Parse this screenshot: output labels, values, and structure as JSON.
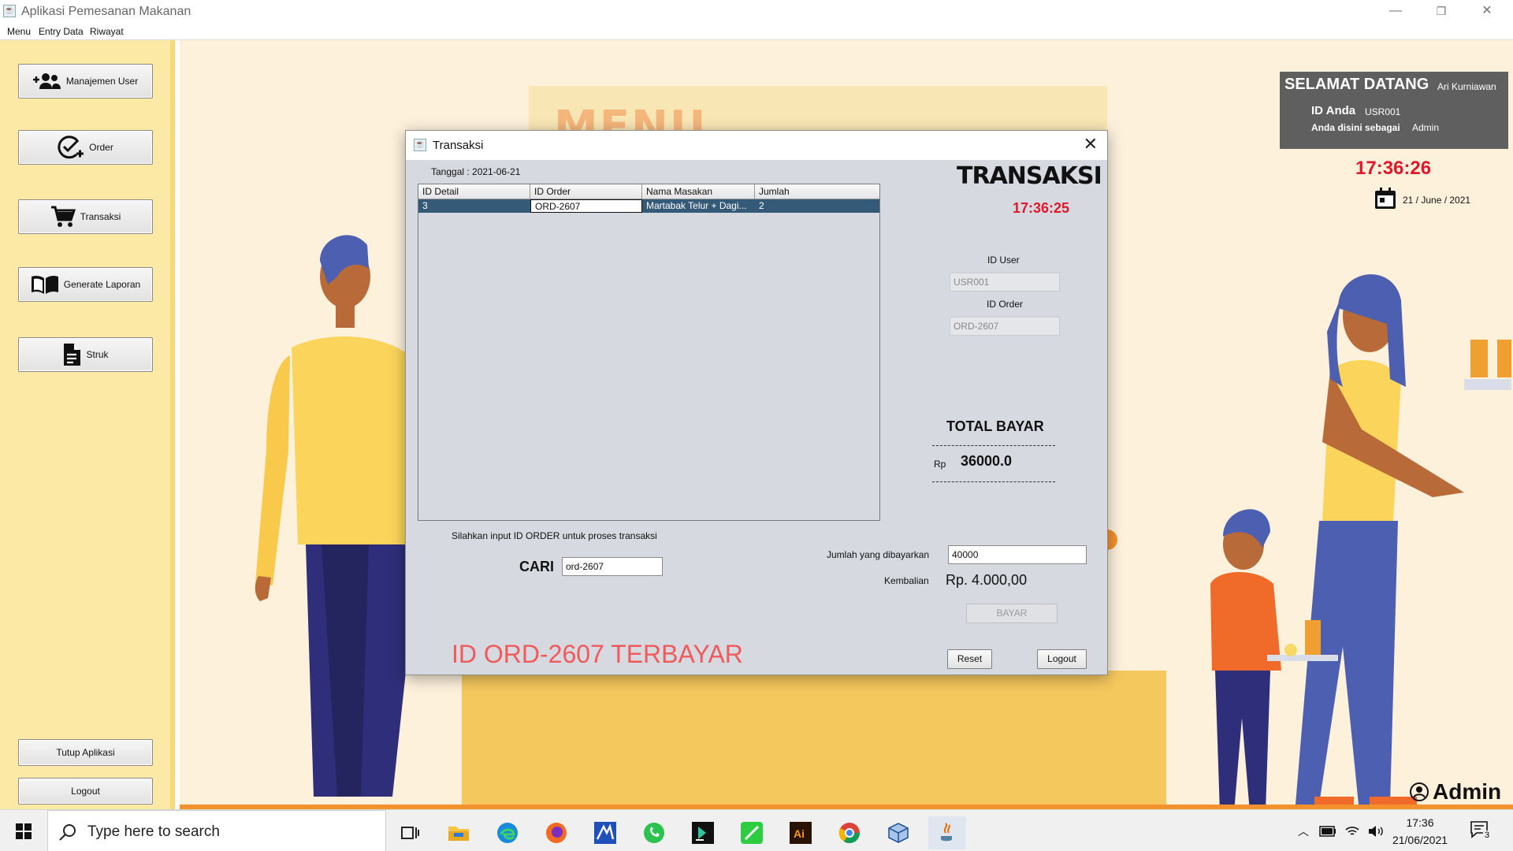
{
  "window": {
    "title": "Aplikasi Pemesanan Makanan",
    "minimize": "—",
    "maximize": "❐",
    "close": "✕"
  },
  "menubar": [
    "Menu",
    "Entry Data",
    "Riwayat"
  ],
  "sidebar": {
    "manajemen_user": "Manajemen User",
    "order": "Order",
    "transaksi": "Transaksi",
    "generate_laporan": "Generate Laporan",
    "struk": "Struk",
    "tutup_aplikasi": "Tutup Aplikasi",
    "logout": "Logout"
  },
  "background": {
    "menu_word": "MENU"
  },
  "welcome": {
    "greeting": "SELAMAT DATANG",
    "user_name": "Ari Kurniawan",
    "id_label": "ID Anda",
    "id_value": "USR001",
    "role_label": "Anda disini sebagai",
    "role_value": "Admin"
  },
  "clock": {
    "time": "17:36:26",
    "date": "21 / June / 2021"
  },
  "admin_badge": "Admin",
  "dialog": {
    "title": "Transaksi",
    "tanggal": "Tanggal :  2021-06-21",
    "table": {
      "columns": [
        "ID Detail",
        "ID Order",
        "Nama Masakan",
        "Jumlah"
      ],
      "rows": [
        [
          "3",
          "ORD-2607",
          "Martabak Telur + Dagi...",
          "2"
        ]
      ]
    },
    "heading": "TRANSAKSI",
    "time": "17:36:25",
    "id_user_label": "ID User",
    "id_user_value": "USR001",
    "id_order_label": "ID Order",
    "id_order_value": "ORD-2607",
    "total_label": "TOTAL BAYAR",
    "currency": "Rp",
    "total_value": "36000.0",
    "hint": "Silahkan input ID ORDER untuk proses transaksi",
    "cari_label": "CARI",
    "cari_value": "ord-2607",
    "jumlah_label": "Jumlah yang dibayarkan",
    "jumlah_value": "40000",
    "kembalian_label": "Kembalian",
    "kembalian_value": "Rp. 4.000,00",
    "bayar": "BAYAR",
    "reset": "Reset",
    "logout": "Logout",
    "status_message": "ID ORD-2607 TERBAYAR"
  },
  "taskbar": {
    "search_placeholder": "Type here to search",
    "time": "17:36",
    "date": "21/06/2021",
    "notification_count": "3",
    "pinned": [
      "task-view",
      "file-explorer",
      "edge",
      "firefox",
      "app-blue",
      "whatsapp",
      "intellij",
      "app-green",
      "illustrator",
      "chrome",
      "virtualbox",
      "java"
    ]
  }
}
